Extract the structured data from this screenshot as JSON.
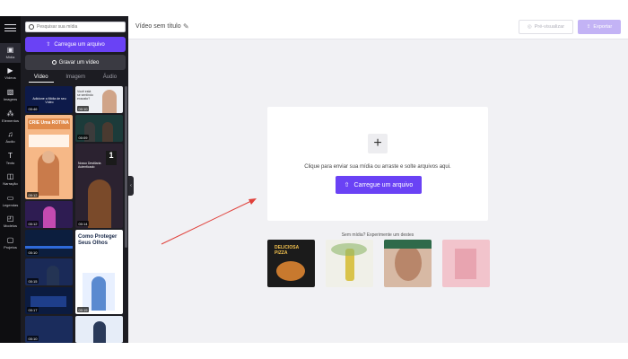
{
  "rail": {
    "items": [
      {
        "icon": "film-icon",
        "label": "Mídia"
      },
      {
        "icon": "video-icon",
        "label": "Vídeos"
      },
      {
        "icon": "image-icon",
        "label": "Imagens"
      },
      {
        "icon": "elements-icon",
        "label": "Elementos"
      },
      {
        "icon": "music-icon",
        "label": "Áudio"
      },
      {
        "icon": "text-icon",
        "label": "Texto"
      },
      {
        "icon": "narration-icon",
        "label": "Narração"
      },
      {
        "icon": "captions-icon",
        "label": "Legendas"
      },
      {
        "icon": "template-icon",
        "label": "Modelos"
      },
      {
        "icon": "folder-icon",
        "label": "Projetos"
      }
    ]
  },
  "panel": {
    "search_placeholder": "Pesquisar sua mídia",
    "upload_label": "Carregue um arquivo",
    "record_label": "Gravar um vídeo",
    "tabs": [
      "Vídeo",
      "Imagem",
      "Áudio"
    ],
    "thumbs": [
      {
        "dur": "00:46",
        "bg": "#0d1a4a",
        "caption": "Adicione a Mídia de seu Vídeo"
      },
      {
        "dur": "00:10",
        "bg": "#eef0f4",
        "caption": "Você está se sentindo exausto?"
      },
      {
        "dur": "00:12",
        "bg": "#f6b887",
        "caption": "CRIE Uma ROTINA"
      },
      {
        "dur": "00:09",
        "bg": "#1c3b3a",
        "caption": ""
      },
      {
        "dur": "00:14",
        "bg": "#2b2230",
        "caption": "Nosso Destilaria Autenticado"
      },
      {
        "dur": "00:12",
        "bg": "#2e1c52",
        "caption": ""
      },
      {
        "dur": "00:10",
        "bg": "#0c1e3e",
        "caption": ""
      },
      {
        "dur": "00:15",
        "bg": "#1a2a58",
        "caption": ""
      },
      {
        "dur": "00:19",
        "bg": "#ffffff",
        "caption": "Como Proteger Seus Olhos"
      },
      {
        "dur": "00:17",
        "bg": "#0b1b40",
        "caption": ""
      },
      {
        "dur": "00:10",
        "bg": "#1a2c5c",
        "caption": ""
      },
      {
        "dur": "",
        "bg": "#e6edf8",
        "caption": ""
      }
    ]
  },
  "topbar": {
    "title": "Vídeo sem título",
    "preview_label": "Pré-visualizar",
    "export_label": "Exportar"
  },
  "card": {
    "instruction": "Clique para enviar sua mídia ou arraste e solte arquivos aqui.",
    "upload_label": "Carregue um arquivo"
  },
  "samples": {
    "prompt": "Sem mídia? Experimente um destes",
    "items": [
      {
        "label": "DELICIOSA PIZZA",
        "bg": "#1b1b1b"
      },
      {
        "label": "",
        "bg": "#f0f0e8"
      },
      {
        "label": "",
        "bg": "#d7b9a4"
      },
      {
        "label": "",
        "bg": "#f2c4cc"
      }
    ]
  },
  "colors": {
    "accent": "#6a42f5",
    "annotation_arrow": "#e0403a"
  }
}
